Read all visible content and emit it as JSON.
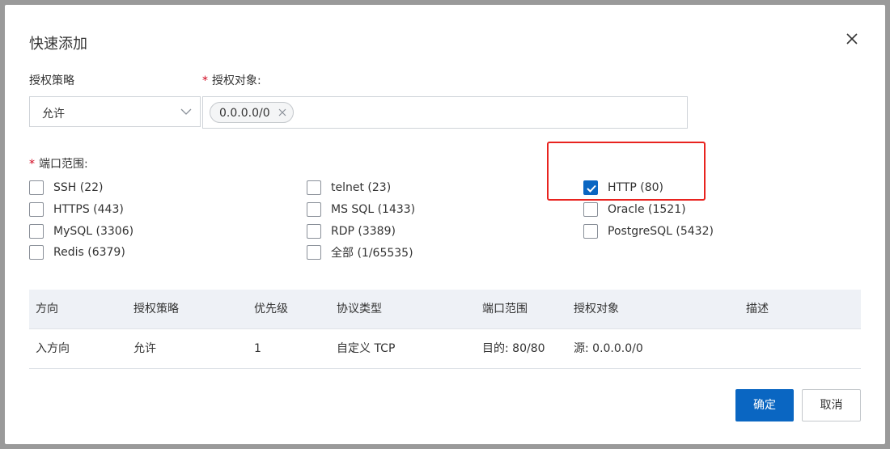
{
  "dialog": {
    "title": "快速添加",
    "close_icon": "close-icon"
  },
  "policy": {
    "label": "授权策略",
    "value": "允许"
  },
  "target": {
    "label": "授权对象:",
    "required_mark": "*",
    "tags": [
      "0.0.0.0/0"
    ]
  },
  "ports": {
    "label": "端口范围:",
    "required_mark": "*",
    "options": [
      {
        "label": "SSH (22)",
        "checked": false
      },
      {
        "label": "telnet (23)",
        "checked": false
      },
      {
        "label": "HTTP (80)",
        "checked": true
      },
      {
        "label": "HTTPS (443)",
        "checked": false
      },
      {
        "label": "MS SQL (1433)",
        "checked": false
      },
      {
        "label": "Oracle (1521)",
        "checked": false
      },
      {
        "label": "MySQL (3306)",
        "checked": false
      },
      {
        "label": "RDP (3389)",
        "checked": false
      },
      {
        "label": "PostgreSQL (5432)",
        "checked": false
      },
      {
        "label": "Redis (6379)",
        "checked": false
      },
      {
        "label": "全部 (1/65535)",
        "checked": false
      }
    ]
  },
  "table": {
    "headers": [
      "方向",
      "授权策略",
      "优先级",
      "协议类型",
      "端口范围",
      "授权对象",
      "描述"
    ],
    "rows": [
      [
        "入方向",
        "允许",
        "1",
        "自定义 TCP",
        "目的: 80/80",
        "源: 0.0.0.0/0",
        ""
      ]
    ]
  },
  "buttons": {
    "confirm": "确定",
    "cancel": "取消"
  },
  "colors": {
    "primary": "#0a66c2",
    "highlight": "#e8231f",
    "required": "#d0021b"
  }
}
